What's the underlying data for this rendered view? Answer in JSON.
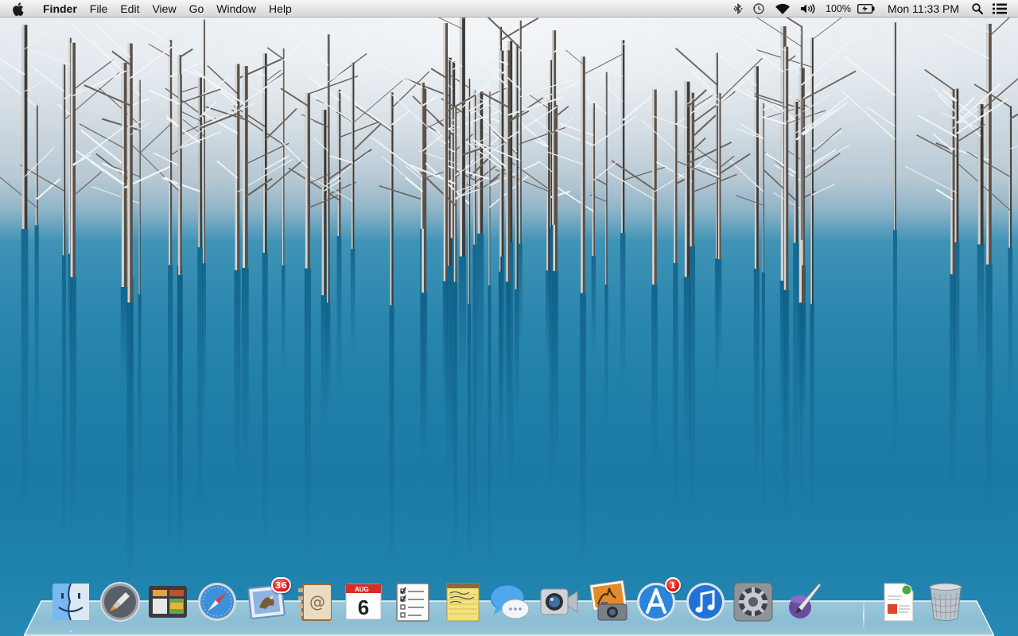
{
  "menubar": {
    "app_name": "Finder",
    "menus": [
      "File",
      "Edit",
      "View",
      "Go",
      "Window",
      "Help"
    ],
    "status": {
      "battery_percent": "100%",
      "clock": "Mon 11:33 PM"
    }
  },
  "dock": {
    "items": [
      {
        "name": "Finder",
        "icon": "finder-icon",
        "running": true
      },
      {
        "name": "Launchpad",
        "icon": "launchpad-icon"
      },
      {
        "name": "Mission Control",
        "icon": "mission-control-icon"
      },
      {
        "name": "Safari",
        "icon": "safari-icon"
      },
      {
        "name": "Mail",
        "icon": "mail-icon",
        "badge": "36"
      },
      {
        "name": "Contacts",
        "icon": "contacts-icon"
      },
      {
        "name": "Calendar",
        "icon": "calendar-icon",
        "month": "AUG",
        "day": "6"
      },
      {
        "name": "Reminders",
        "icon": "reminders-icon"
      },
      {
        "name": "Notes",
        "icon": "notes-icon"
      },
      {
        "name": "Messages",
        "icon": "messages-icon"
      },
      {
        "name": "FaceTime",
        "icon": "facetime-icon"
      },
      {
        "name": "Photo Booth",
        "icon": "photo-booth-icon"
      },
      {
        "name": "App Store",
        "icon": "app-store-icon",
        "badge": "1"
      },
      {
        "name": "iTunes",
        "icon": "itunes-icon"
      },
      {
        "name": "System Preferences",
        "icon": "system-preferences-icon"
      },
      {
        "name": "Script Editor",
        "icon": "script-editor-icon"
      },
      {
        "name": "Documents",
        "icon": "document-stack-icon"
      },
      {
        "name": "Trash",
        "icon": "trash-icon"
      }
    ]
  },
  "colors": {
    "menubar_bg": "#e4e4e4",
    "water": "#1f7fa9",
    "snow": "#e9eef2",
    "badge": "#d4160c"
  }
}
